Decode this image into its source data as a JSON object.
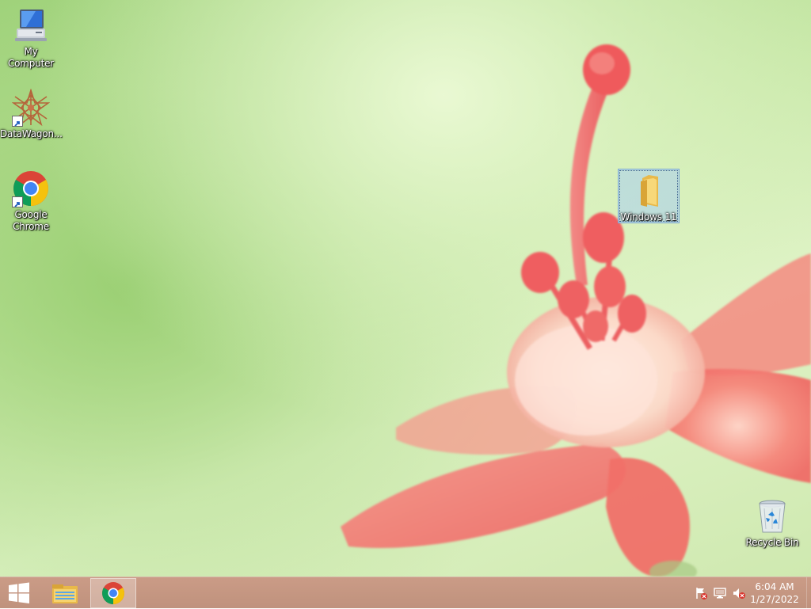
{
  "desktop": {
    "icons": [
      {
        "name": "my-computer",
        "label": "My Computer",
        "icon": "computer-icon"
      },
      {
        "name": "datawagon",
        "label": "DataWagon...",
        "icon": "datawagon-app-icon",
        "shortcut": true
      },
      {
        "name": "google-chrome",
        "label": "Google Chrome",
        "icon": "chrome-icon",
        "shortcut": true
      },
      {
        "name": "windows-11-folder",
        "label": "Windows 11",
        "icon": "folder-icon",
        "selected": true
      },
      {
        "name": "recycle-bin",
        "label": "Recycle Bin",
        "icon": "recycle-bin-icon"
      }
    ]
  },
  "taskbar": {
    "buttons": [
      {
        "name": "start",
        "icon": "windows-logo-icon"
      },
      {
        "name": "file-explorer",
        "icon": "file-explorer-icon"
      },
      {
        "name": "google-chrome",
        "icon": "chrome-icon",
        "active": true
      }
    ],
    "tray": {
      "icons": [
        "action-center-flag-icon",
        "network-icon",
        "volume-muted-icon"
      ]
    },
    "clock": {
      "time": "6:04 AM",
      "date": "1/27/2022"
    }
  },
  "colors": {
    "taskbar": "#c49280",
    "wallpaper_green": "#b9e196",
    "flower_coral": "#f26d6b",
    "selection": "#aacdf0"
  }
}
